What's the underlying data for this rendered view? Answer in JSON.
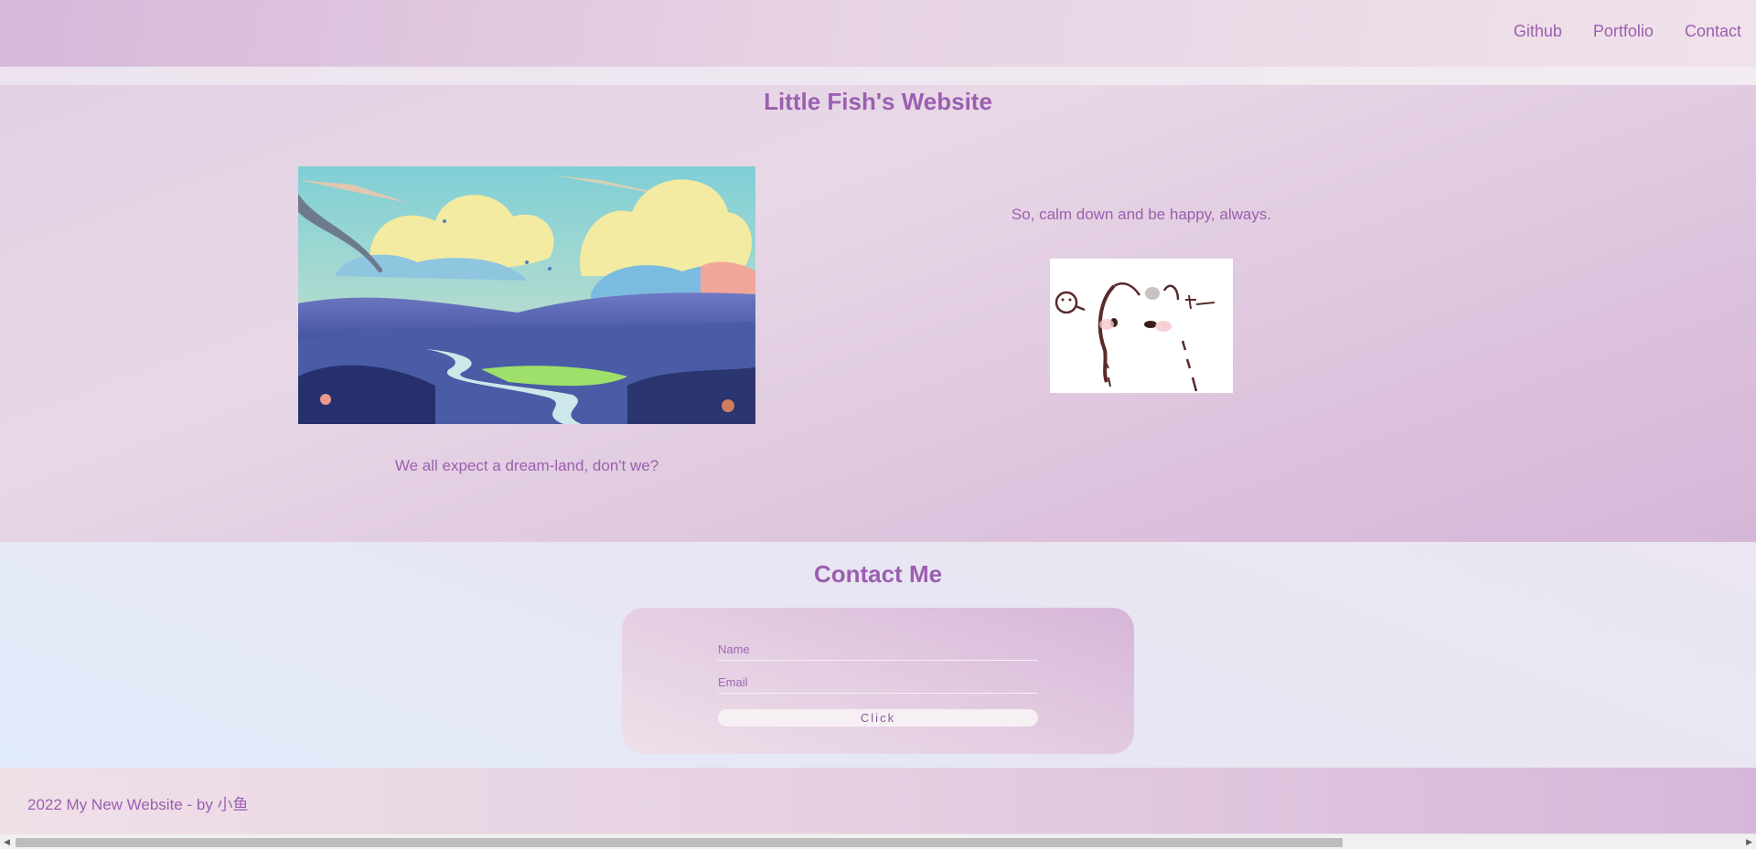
{
  "nav": {
    "items": [
      "Github",
      "Portfolio",
      "Contact"
    ]
  },
  "hero": {
    "title": "Little Fish's Website",
    "image_caption": "We all expect a dream-land, don't we?",
    "quote": "So, calm down and be happy, always."
  },
  "contact": {
    "title": "Contact Me",
    "name_placeholder": "Name",
    "email_placeholder": "Email",
    "submit_label": "Click"
  },
  "footer": {
    "text": "2022 My New Website - by 小鱼"
  },
  "colors": {
    "accent": "#9b5fb0",
    "header_start": "#d6b8d9",
    "contact_bg": "#e6e9f6"
  },
  "scrollbar": {
    "left_arrow": "◀",
    "right_arrow": "▶"
  }
}
